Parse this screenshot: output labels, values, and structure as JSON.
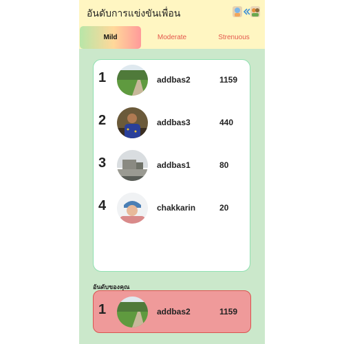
{
  "header": {
    "title": "อันดับการแข่งขันเพื่อน",
    "icons": [
      "avatar-icon",
      "back-arrows-icon",
      "friends-icon"
    ]
  },
  "tabs": [
    {
      "label": "Mild",
      "active": true
    },
    {
      "label": "Moderate",
      "active": false
    },
    {
      "label": "Strenuous",
      "active": false
    }
  ],
  "leaderboard": [
    {
      "rank": "1",
      "name": "addbas2",
      "score": "1159",
      "avatar": "outdoor-grass-photo"
    },
    {
      "rank": "2",
      "name": "addbas3",
      "score": "440",
      "avatar": "person-photo"
    },
    {
      "rank": "3",
      "name": "addbas1",
      "score": "80",
      "avatar": "building-photo"
    },
    {
      "rank": "4",
      "name": "chakkarin",
      "score": "20",
      "avatar": "person-cap-photo"
    }
  ],
  "your_rank": {
    "label": "อันดับของคุณ",
    "rank": "1",
    "name": "addbas2",
    "score": "1159",
    "avatar": "outdoor-grass-photo"
  },
  "colors": {
    "header_bg": "#fff6c2",
    "app_bg": "#cbe8cb",
    "tab_inactive_text": "#e4574c",
    "your_card_bg": "#ef9a9a"
  }
}
